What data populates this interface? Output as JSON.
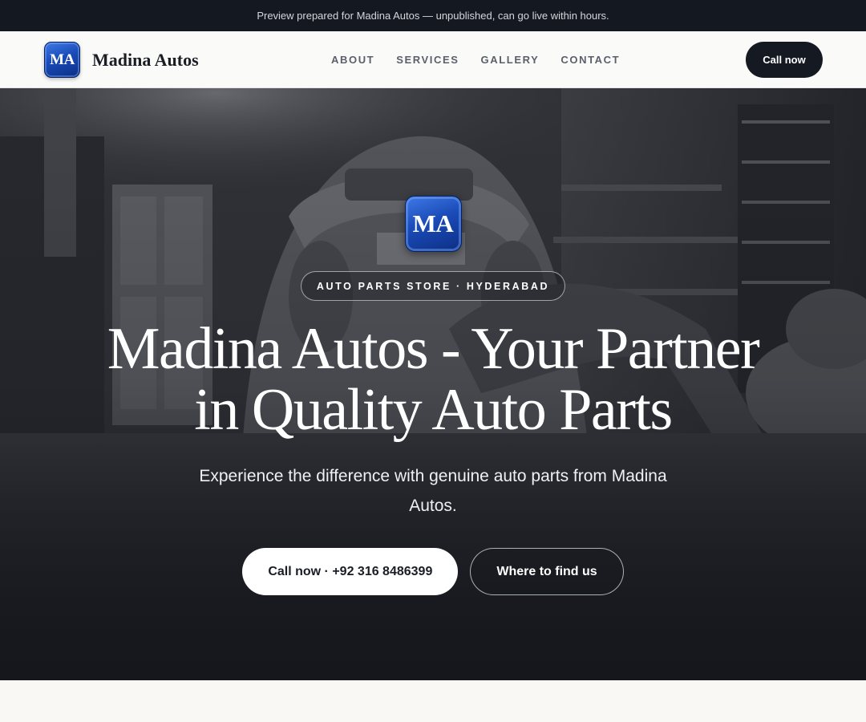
{
  "banner": {
    "text": "Preview prepared for Madina Autos — unpublished, can go live within hours."
  },
  "nav": {
    "logo_initials": "MA",
    "brand_name": "Madina Autos",
    "links": [
      "ABOUT",
      "SERVICES",
      "GALLERY",
      "CONTACT"
    ],
    "cta_label": "Call now"
  },
  "hero": {
    "logo_initials": "MA",
    "badge": "AUTO PARTS STORE · HYDERABAD",
    "title": "Madina Autos - Your Partner in Quality Auto Parts",
    "subtitle": "Experience the difference with genuine auto parts from Madina Autos.",
    "primary_button": "Call now · +92 316 8486399",
    "secondary_button": "Where to find us"
  },
  "colors": {
    "banner_bg": "#141820",
    "cta_bg": "#151922",
    "logo_blue": "#1a4bb8"
  }
}
